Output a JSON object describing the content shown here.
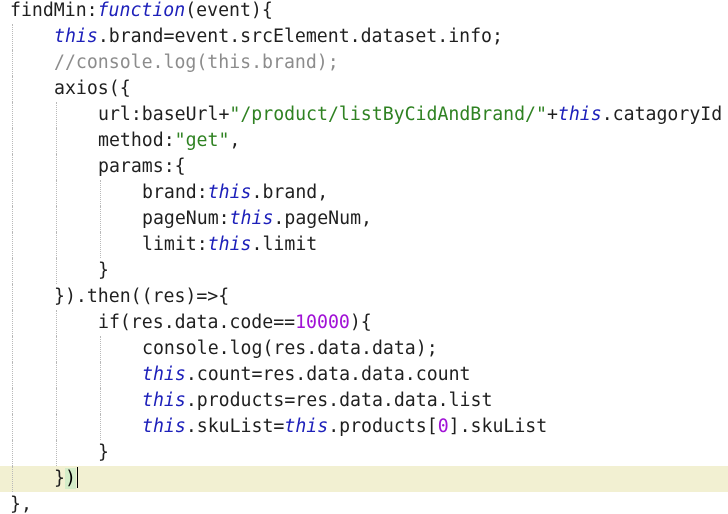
{
  "editor": {
    "lines": [
      [
        {
          "t": "findMin",
          "c": "t-default"
        },
        {
          "t": ":",
          "c": "t-default"
        },
        {
          "t": "function",
          "c": "t-kw"
        },
        {
          "t": "(event){",
          "c": "t-default"
        }
      ],
      [
        {
          "t": "this",
          "c": "t-kw"
        },
        {
          "t": ".brand=event.srcElement.dataset.info;",
          "c": "t-default"
        }
      ],
      [
        {
          "t": "//console.log(this.brand);",
          "c": "t-comment"
        }
      ],
      [
        {
          "t": "axios({",
          "c": "t-default"
        }
      ],
      [
        {
          "t": "url:baseUrl+",
          "c": "t-default"
        },
        {
          "t": "\"/product/listByCidAndBrand/\"",
          "c": "t-str"
        },
        {
          "t": "+",
          "c": "t-default"
        },
        {
          "t": "this",
          "c": "t-kw"
        },
        {
          "t": ".catagoryId",
          "c": "t-default"
        }
      ],
      [
        {
          "t": "method:",
          "c": "t-default"
        },
        {
          "t": "\"get\"",
          "c": "t-str"
        },
        {
          "t": ",",
          "c": "t-default"
        }
      ],
      [
        {
          "t": "params:{",
          "c": "t-default"
        }
      ],
      [
        {
          "t": "brand:",
          "c": "t-default"
        },
        {
          "t": "this",
          "c": "t-kw"
        },
        {
          "t": ".brand,",
          "c": "t-default"
        }
      ],
      [
        {
          "t": "pageNum:",
          "c": "t-default"
        },
        {
          "t": "this",
          "c": "t-kw"
        },
        {
          "t": ".pageNum,",
          "c": "t-default"
        }
      ],
      [
        {
          "t": "limit:",
          "c": "t-default"
        },
        {
          "t": "this",
          "c": "t-kw"
        },
        {
          "t": ".limit",
          "c": "t-default"
        }
      ],
      [
        {
          "t": "}",
          "c": "t-default"
        }
      ],
      [
        {
          "t": "}).then(",
          "c": "t-default"
        },
        {
          "t": "(res)=>{",
          "c": "t-default"
        }
      ],
      [
        {
          "t": "if(res.data.code==",
          "c": "t-default"
        },
        {
          "t": "10000",
          "c": "t-num"
        },
        {
          "t": "){",
          "c": "t-default"
        }
      ],
      [
        {
          "t": "console.log(res.data.data);",
          "c": "t-default"
        }
      ],
      [
        {
          "t": "this",
          "c": "t-kw"
        },
        {
          "t": ".count=res.data.data.count",
          "c": "t-default"
        }
      ],
      [
        {
          "t": "this",
          "c": "t-kw"
        },
        {
          "t": ".products=res.data.data.list",
          "c": "t-default"
        }
      ],
      [
        {
          "t": "this",
          "c": "t-kw"
        },
        {
          "t": ".skuList=",
          "c": "t-default"
        },
        {
          "t": "this",
          "c": "t-kw"
        },
        {
          "t": ".products[",
          "c": "t-default"
        },
        {
          "t": "0",
          "c": "t-num"
        },
        {
          "t": "].skuList",
          "c": "t-default"
        }
      ],
      [
        {
          "t": "}",
          "c": "t-default"
        }
      ],
      [
        {
          "t": "}",
          "c": "t-default"
        },
        {
          "t": ")",
          "c": "t-bracket-hl"
        }
      ],
      [
        {
          "t": "},",
          "c": "t-default"
        }
      ]
    ]
  }
}
